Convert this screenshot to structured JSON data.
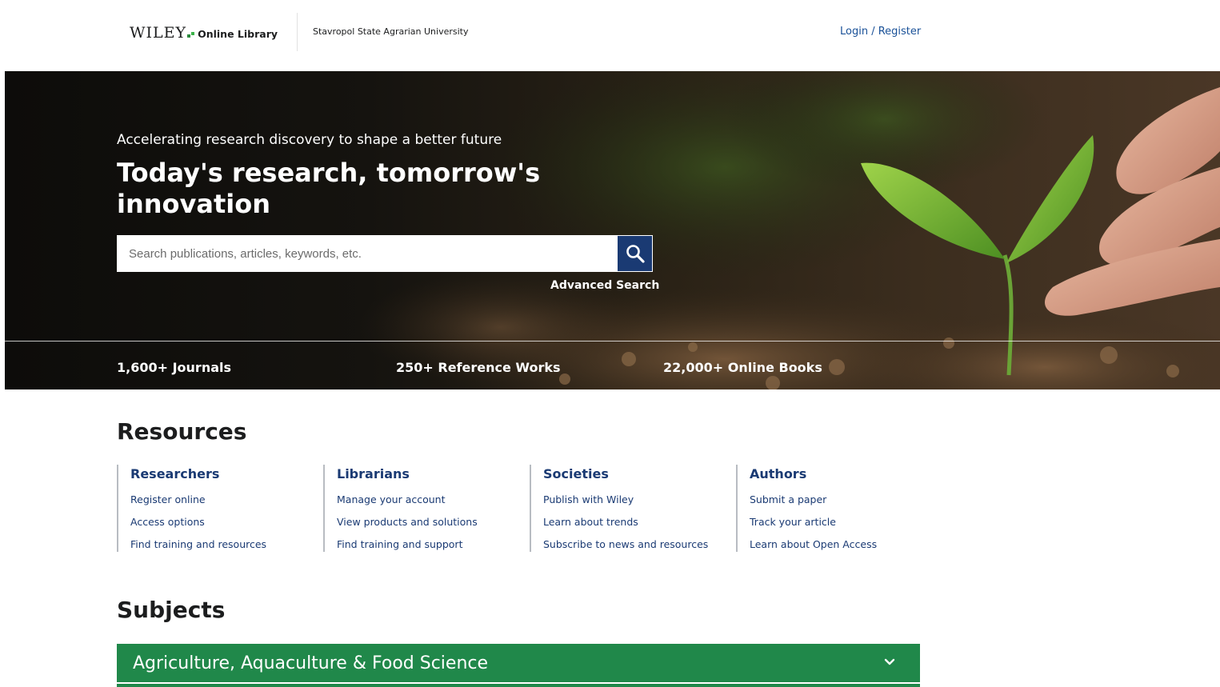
{
  "header": {
    "logo_wiley": "WILEY",
    "logo_online_library": "Online Library",
    "institution": "Stavropol State Agrarian University",
    "login_label": "Login / Register"
  },
  "hero": {
    "tagline": "Accelerating research discovery to shape a better future",
    "title": "Today's research, tomorrow's innovation",
    "search_placeholder": "Search publications, articles, keywords, etc.",
    "search_icon": "search-icon",
    "advanced_search": "Advanced Search",
    "stats": [
      "1,600+ Journals",
      "250+ Reference Works",
      "22,000+ Online Books"
    ]
  },
  "resources": {
    "title": "Resources",
    "columns": [
      {
        "heading": "Researchers",
        "links": [
          "Register online",
          "Access options",
          "Find training and resources"
        ]
      },
      {
        "heading": "Librarians",
        "links": [
          "Manage your account",
          "View products and solutions",
          "Find training and support"
        ]
      },
      {
        "heading": "Societies",
        "links": [
          "Publish with Wiley",
          "Learn about trends",
          "Subscribe to news and resources"
        ]
      },
      {
        "heading": "Authors",
        "links": [
          "Submit a paper",
          "Track your article",
          "Learn about Open Access"
        ]
      }
    ]
  },
  "subjects": {
    "title": "Subjects",
    "items": [
      {
        "label": "Agriculture, Aquaculture & Food Science",
        "icon": "chevron-down-icon"
      }
    ]
  },
  "colors": {
    "link_blue": "#1a3a73",
    "search_button": "#1a3a73",
    "subject_green": "#20884a"
  }
}
